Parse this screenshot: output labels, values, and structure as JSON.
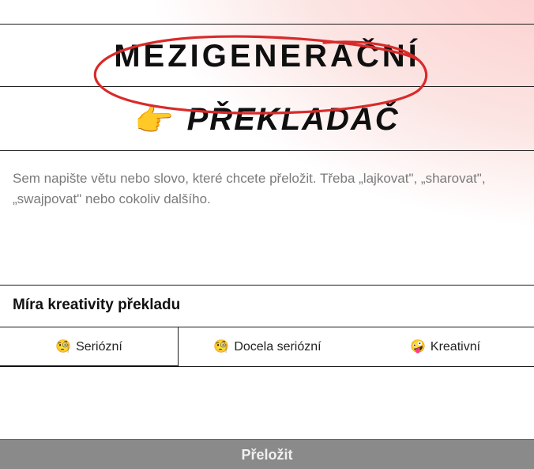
{
  "title": {
    "line1": "MEZIGENERAČNÍ",
    "line2": "PŘEKLADAČ",
    "pointing_emoji": "👉"
  },
  "input": {
    "placeholder": "Sem napište větu nebo slovo, které chcete přeložit. Třeba „lajkovat\", „sharovat\", „swajpovat\" nebo cokoliv dalšího."
  },
  "creativity": {
    "label": "Míra kreativity překladu",
    "options": [
      {
        "emoji": "🧐",
        "label": "Seriózní",
        "selected": true
      },
      {
        "emoji": "🧐",
        "label": "Docela seriózní",
        "selected": false
      },
      {
        "emoji": "🤪",
        "label": "Kreativní",
        "selected": false
      }
    ]
  },
  "translate_button": "Přeložit"
}
